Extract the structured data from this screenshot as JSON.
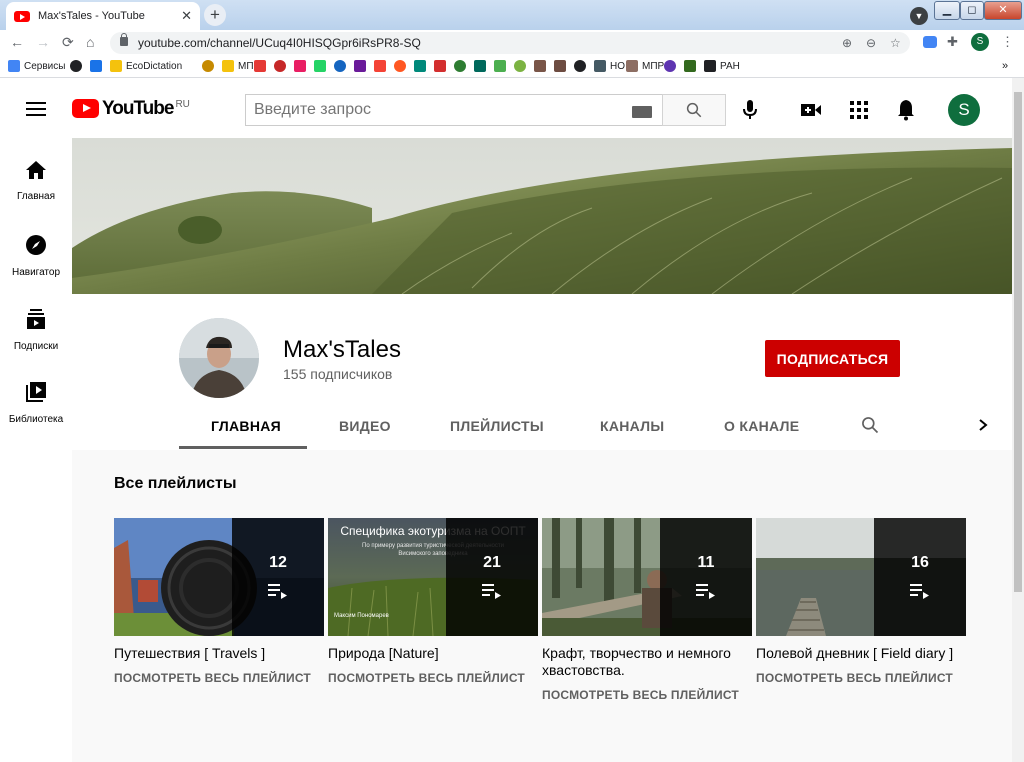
{
  "browser": {
    "tab_title": "Max'sTales - YouTube",
    "tab_close": "✕",
    "new_tab": "+",
    "url": "youtube.com/channel/UCuq4I0HISQGpr6iRsPR8-SQ",
    "profile_letter": "S",
    "window_buttons": {
      "minimize": "▁",
      "maximize": "◻",
      "close": "✕"
    }
  },
  "bookmarks": [
    {
      "label": "Сервисы",
      "color": "#4285f4"
    },
    {
      "label": "",
      "color": "#202124"
    },
    {
      "label": "",
      "color": "#1a73e8"
    },
    {
      "label": "EcoDictation",
      "color": "#f4c20d"
    },
    {
      "label": "",
      "color": "#c68a00"
    },
    {
      "label": "МП",
      "color": "#f4c20d"
    },
    {
      "label": "",
      "color": "#e53935"
    },
    {
      "label": "",
      "color": "#c62828"
    },
    {
      "label": "",
      "color": "#e91e63"
    },
    {
      "label": "",
      "color": "#25d366"
    },
    {
      "label": "",
      "color": "#1565c0"
    },
    {
      "label": "",
      "color": "#6a1b9a"
    },
    {
      "label": "",
      "color": "#f44336"
    },
    {
      "label": "",
      "color": "#ff5722"
    },
    {
      "label": "",
      "color": "#00897b"
    },
    {
      "label": "",
      "color": "#d32f2f"
    },
    {
      "label": "",
      "color": "#2e7d32"
    },
    {
      "label": "",
      "color": "#00695c"
    },
    {
      "label": "",
      "color": "#4caf50"
    },
    {
      "label": "",
      "color": "#7cb342"
    },
    {
      "label": "",
      "color": "#795548"
    },
    {
      "label": "",
      "color": "#6d4c41"
    },
    {
      "label": "",
      "color": "#202124"
    },
    {
      "label": "НО",
      "color": "#455a64"
    },
    {
      "label": "МПР",
      "color": "#8d6e63"
    },
    {
      "label": "",
      "color": "#5e35b1"
    },
    {
      "label": "",
      "color": "#33691e"
    },
    {
      "label": "РАН",
      "color": "#202124"
    }
  ],
  "bookmarks_more": "»",
  "header": {
    "logo_text": "YouTube",
    "logo_country": "RU",
    "search_placeholder": "Введите запрос",
    "account_letter": "S"
  },
  "sidebar": [
    {
      "label": "Главная",
      "icon": "home-icon"
    },
    {
      "label": "Навигатор",
      "icon": "compass-icon"
    },
    {
      "label": "Подписки",
      "icon": "subscriptions-icon"
    },
    {
      "label": "Библиотека",
      "icon": "library-icon"
    }
  ],
  "channel": {
    "name": "Max'sTales",
    "subscribers": "155 подписчиков",
    "subscribe_label": "ПОДПИСАТЬСЯ",
    "tabs": [
      "ГЛАВНАЯ",
      "ВИДЕО",
      "ПЛЕЙЛИСТЫ",
      "КАНАЛЫ",
      "О КАНАЛЕ"
    ],
    "active_tab": "ГЛАВНАЯ"
  },
  "section": {
    "title": "Все плейлисты",
    "view_all_label": "ПОСМОТРЕТЬ ВЕСЬ ПЛЕЙЛИСТ",
    "playlists": [
      {
        "title": "Путешествия [ Travels ]",
        "count": "12"
      },
      {
        "title": "Природа [Nature]",
        "count": "21",
        "thumb_heading": "Специфика экотуризма на ООПТ",
        "thumb_sub": "По примеру развития туристической деятельности Висимского заповедника",
        "thumb_author": "Максим Пономарев"
      },
      {
        "title": "Крафт, творчество и немного хвастовства.",
        "count": "11"
      },
      {
        "title": "Полевой дневник [ Field diary ]",
        "count": "16"
      }
    ]
  },
  "colors": {
    "youtube_red": "#ff0000",
    "subscribe_red": "#cc0000",
    "avatar_green": "#0f6e3e"
  }
}
